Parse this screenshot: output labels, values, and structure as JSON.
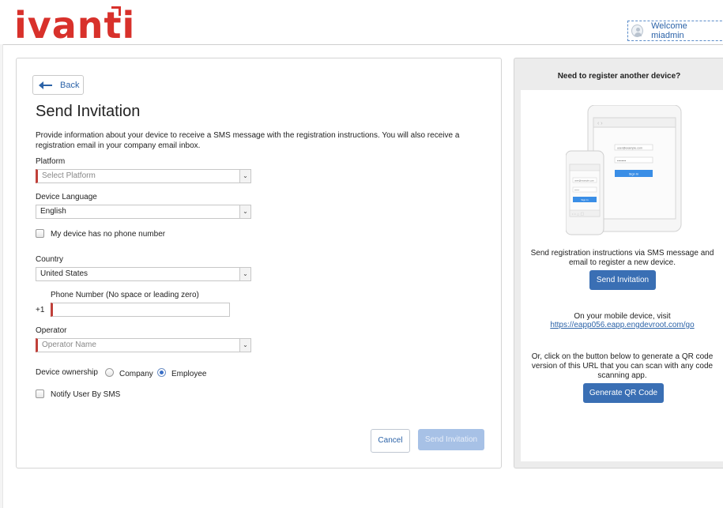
{
  "header": {
    "logo_text": "ivanti",
    "welcome_text": "Welcome miadmin"
  },
  "form": {
    "back_label": "Back",
    "title": "Send Invitation",
    "description": "Provide information about your device to receive a SMS message with the registration instructions. You will also receive a registration email in your company email inbox.",
    "platform": {
      "label": "Platform",
      "placeholder": "Select Platform"
    },
    "device_language": {
      "label": "Device Language",
      "value": "English"
    },
    "no_phone_checkbox": {
      "label": "My device has no phone number",
      "checked": false
    },
    "country": {
      "label": "Country",
      "value": "United States"
    },
    "phone": {
      "label": "Phone Number (No space or leading zero)",
      "prefix": "+1",
      "value": ""
    },
    "operator": {
      "label": "Operator",
      "placeholder": "Operator Name"
    },
    "ownership": {
      "label": "Device ownership",
      "options": [
        "Company",
        "Employee"
      ],
      "selected": "Employee"
    },
    "notify_sms": {
      "label": "Notify User By SMS",
      "checked": false
    },
    "cancel_label": "Cancel",
    "send_label": "Send Invitation"
  },
  "side": {
    "heading": "Need to register another device?",
    "illustration": {
      "tablet_email": "user@example.com",
      "tablet_password": "••••••••",
      "tablet_button": "Sign In",
      "phone_email": "user@example.com",
      "phone_password": "••••••",
      "phone_button": "Sign In"
    },
    "sms_text": "Send registration instructions via SMS message and email to register a new device.",
    "sms_button": "Send Invitation",
    "visit_text": "On your mobile device, visit",
    "visit_url": "https://eapp056.eapp.engdevroot.com/go",
    "qr_text": "Or, click on the button below to generate a QR code version of this URL that you can scan with any code scanning app.",
    "qr_button": "Generate QR Code"
  },
  "colors": {
    "brand_red": "#d8312b",
    "accent_blue": "#3a6fb4",
    "link_blue": "#2c63a8",
    "required_marker": "#c0403a"
  }
}
